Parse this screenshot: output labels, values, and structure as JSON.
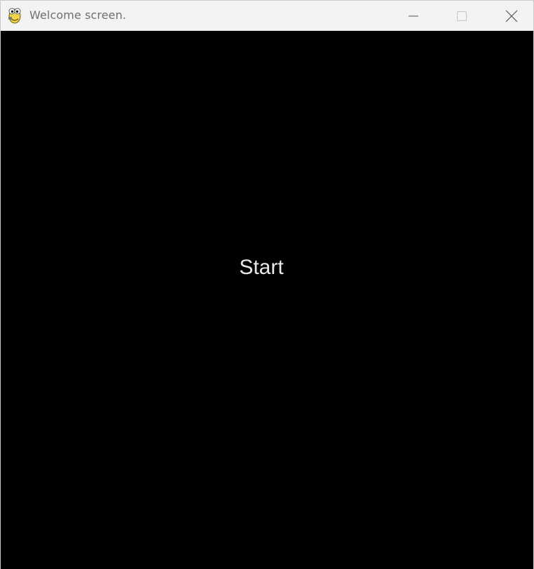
{
  "window": {
    "title": "Welcome screen.",
    "app_icon": "pygame-snake-icon",
    "controls": {
      "minimize_icon": "minimize-icon",
      "maximize_icon": "maximize-icon",
      "close_icon": "close-icon"
    }
  },
  "main": {
    "start_label": "Start",
    "background_color": "#000000",
    "text_color": "#e8e8e8"
  }
}
